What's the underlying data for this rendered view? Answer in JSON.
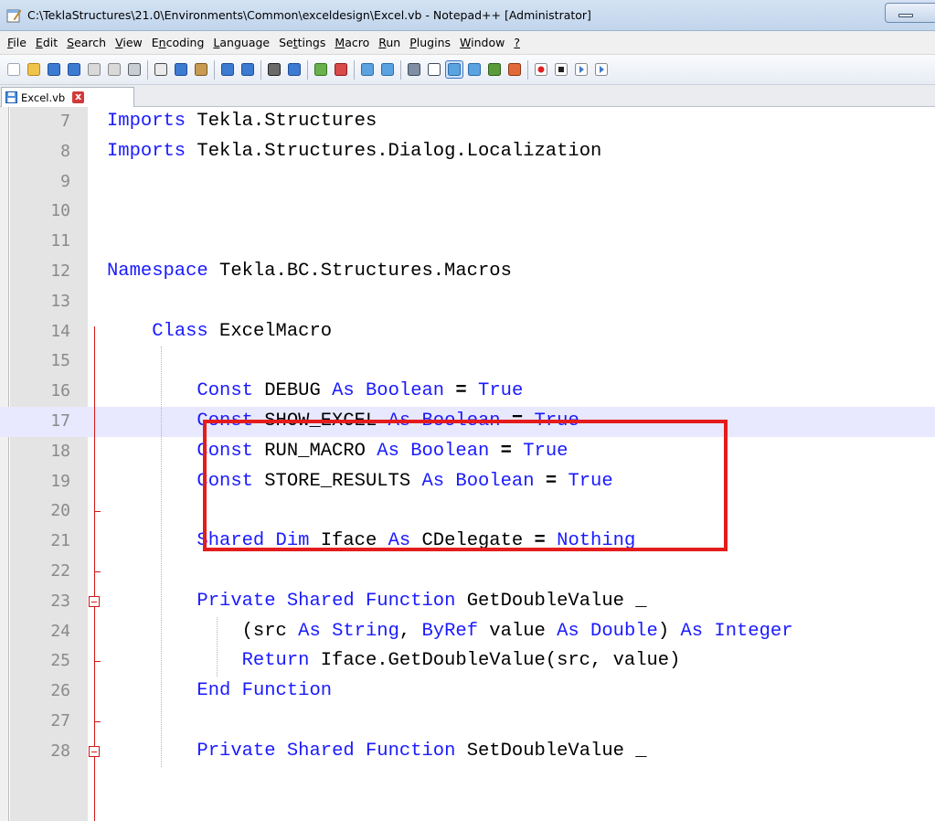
{
  "window": {
    "title": "C:\\TeklaStructures\\21.0\\Environments\\Common\\exceldesign\\Excel.vb - Notepad++ [Administrator]"
  },
  "menu": [
    {
      "pre": "",
      "acc": "F",
      "post": "ile"
    },
    {
      "pre": "",
      "acc": "E",
      "post": "dit"
    },
    {
      "pre": "",
      "acc": "S",
      "post": "earch"
    },
    {
      "pre": "",
      "acc": "V",
      "post": "iew"
    },
    {
      "pre": "E",
      "acc": "n",
      "post": "coding"
    },
    {
      "pre": "",
      "acc": "L",
      "post": "anguage"
    },
    {
      "pre": "Se",
      "acc": "t",
      "post": "tings"
    },
    {
      "pre": "",
      "acc": "M",
      "post": "acro"
    },
    {
      "pre": "",
      "acc": "R",
      "post": "un"
    },
    {
      "pre": "",
      "acc": "P",
      "post": "lugins"
    },
    {
      "pre": "",
      "acc": "W",
      "post": "indow"
    },
    {
      "pre": "",
      "acc": "?",
      "post": ""
    }
  ],
  "toolbar": {
    "buttons": [
      "new-file-icon",
      "open-file-icon",
      "save-icon",
      "save-all-icon",
      "close-icon",
      "close-all-icon",
      "print-icon",
      "cut-icon",
      "copy-icon",
      "paste-icon",
      "undo-icon",
      "redo-icon",
      "find-icon",
      "replace-icon",
      "zoom-in-icon",
      "zoom-out-icon",
      "sync-vertical-icon",
      "sync-horizontal-icon",
      "word-wrap-icon",
      "show-all-chars-icon",
      "indent-guide-icon",
      "user-language-icon",
      "doc-map-icon",
      "function-list-icon",
      "record-macro-icon",
      "stop-macro-icon",
      "play-macro-icon",
      "run-macro-multiple-icon"
    ]
  },
  "tab": {
    "label": "Excel.vb",
    "close": "x"
  },
  "editor": {
    "lines": [
      {
        "n": "7",
        "tokens": [
          [
            "kw",
            "Imports"
          ],
          [
            "t",
            " Tekla.Structures"
          ]
        ]
      },
      {
        "n": "8",
        "tokens": [
          [
            "kw",
            "Imports"
          ],
          [
            "t",
            " Tekla.Structures.Dialog.Localization"
          ]
        ]
      },
      {
        "n": "9",
        "tokens": []
      },
      {
        "n": "10",
        "tokens": []
      },
      {
        "n": "11",
        "tokens": []
      },
      {
        "n": "12",
        "tokens": [
          [
            "kw",
            "Namespace"
          ],
          [
            "t",
            " Tekla.BC.Structures.Macros"
          ]
        ]
      },
      {
        "n": "13",
        "tokens": []
      },
      {
        "n": "14",
        "tokens": [
          [
            "t",
            "    "
          ],
          [
            "kw",
            "Class"
          ],
          [
            "t",
            " ExcelMacro"
          ]
        ]
      },
      {
        "n": "15",
        "tokens": []
      },
      {
        "n": "16",
        "tokens": [
          [
            "t",
            "        "
          ],
          [
            "kw",
            "Const"
          ],
          [
            "t",
            " DEBUG "
          ],
          [
            "kw",
            "As"
          ],
          [
            "t",
            " "
          ],
          [
            "kw",
            "Boolean"
          ],
          [
            "t",
            " "
          ],
          [
            "op",
            "="
          ],
          [
            "t",
            " "
          ],
          [
            "kw",
            "True"
          ]
        ]
      },
      {
        "n": "17",
        "tokens": [
          [
            "t",
            "        "
          ],
          [
            "kw",
            "Const"
          ],
          [
            "t",
            " SHOW_EXCEL "
          ],
          [
            "kw",
            "As"
          ],
          [
            "t",
            " "
          ],
          [
            "kw",
            "Boolean"
          ],
          [
            "t",
            " "
          ],
          [
            "op",
            "="
          ],
          [
            "t",
            " "
          ],
          [
            "kw",
            "True"
          ]
        ]
      },
      {
        "n": "18",
        "tokens": [
          [
            "t",
            "        "
          ],
          [
            "kw",
            "Const"
          ],
          [
            "t",
            " RUN_MACRO "
          ],
          [
            "kw",
            "As"
          ],
          [
            "t",
            " "
          ],
          [
            "kw",
            "Boolean"
          ],
          [
            "t",
            " "
          ],
          [
            "op",
            "="
          ],
          [
            "t",
            " "
          ],
          [
            "kw",
            "True"
          ]
        ]
      },
      {
        "n": "19",
        "tokens": [
          [
            "t",
            "        "
          ],
          [
            "kw",
            "Const"
          ],
          [
            "t",
            " STORE_RESULTS "
          ],
          [
            "kw",
            "As"
          ],
          [
            "t",
            " "
          ],
          [
            "kw",
            "Boolean"
          ],
          [
            "t",
            " "
          ],
          [
            "op",
            "="
          ],
          [
            "t",
            " "
          ],
          [
            "kw",
            "True"
          ]
        ]
      },
      {
        "n": "20",
        "tokens": []
      },
      {
        "n": "21",
        "tokens": [
          [
            "t",
            "        "
          ],
          [
            "kw",
            "Shared"
          ],
          [
            "t",
            " "
          ],
          [
            "kw",
            "Dim"
          ],
          [
            "t",
            " Iface "
          ],
          [
            "kw",
            "As"
          ],
          [
            "t",
            " CDelegate "
          ],
          [
            "op",
            "="
          ],
          [
            "t",
            " "
          ],
          [
            "kw",
            "Nothing"
          ]
        ]
      },
      {
        "n": "22",
        "tokens": []
      },
      {
        "n": "23",
        "tokens": [
          [
            "t",
            "        "
          ],
          [
            "kw",
            "Private"
          ],
          [
            "t",
            " "
          ],
          [
            "kw",
            "Shared"
          ],
          [
            "t",
            " "
          ],
          [
            "kw",
            "Function"
          ],
          [
            "t",
            " GetDoubleValue _"
          ]
        ]
      },
      {
        "n": "24",
        "tokens": [
          [
            "t",
            "            (src "
          ],
          [
            "kw",
            "As"
          ],
          [
            "t",
            " "
          ],
          [
            "kw",
            "String"
          ],
          [
            "t",
            ", "
          ],
          [
            "kw",
            "ByRef"
          ],
          [
            "t",
            " value "
          ],
          [
            "kw",
            "As"
          ],
          [
            "t",
            " "
          ],
          [
            "kw",
            "Double"
          ],
          [
            "t",
            ") "
          ],
          [
            "kw",
            "As"
          ],
          [
            "t",
            " "
          ],
          [
            "kw",
            "Integer"
          ]
        ]
      },
      {
        "n": "25",
        "tokens": [
          [
            "t",
            "            "
          ],
          [
            "kw",
            "Return"
          ],
          [
            "t",
            " Iface.GetDoubleValue(src, value)"
          ]
        ]
      },
      {
        "n": "26",
        "tokens": [
          [
            "t",
            "        "
          ],
          [
            "kw",
            "End"
          ],
          [
            "t",
            " "
          ],
          [
            "kw",
            "Function"
          ]
        ]
      },
      {
        "n": "27",
        "tokens": []
      },
      {
        "n": "28",
        "tokens": [
          [
            "t",
            "        "
          ],
          [
            "kw",
            "Private"
          ],
          [
            "t",
            " "
          ],
          [
            "kw",
            "Shared"
          ],
          [
            "t",
            " "
          ],
          [
            "kw",
            "Function"
          ],
          [
            "t",
            " SetDoubleValue _"
          ]
        ]
      }
    ]
  },
  "colors": {
    "keyword": "#1a1aff",
    "highlight_box": "#e41c1c",
    "fold_margin": "#d01818",
    "current_line": "#e8e8ff"
  }
}
